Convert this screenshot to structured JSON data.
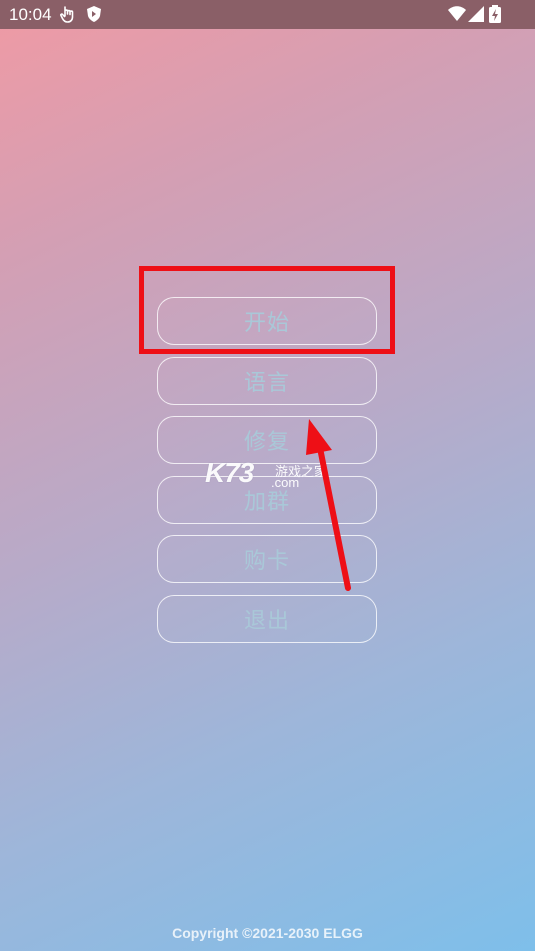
{
  "status_bar": {
    "time": "10:04",
    "icons": [
      "touch-icon",
      "app-shield-icon",
      "wifi-icon",
      "signal-icon",
      "battery-charging-icon"
    ]
  },
  "menu": {
    "items": [
      {
        "label": "开始"
      },
      {
        "label": "语言"
      },
      {
        "label": "修复"
      },
      {
        "label": "加群"
      },
      {
        "label": "购卡"
      },
      {
        "label": "退出"
      }
    ]
  },
  "watermark": {
    "logo": "K73",
    "cn": "游戏之家",
    "domain": ".com"
  },
  "footer": {
    "copyright": "Copyright ©2021-2030 ELGG"
  },
  "colors": {
    "gradient_start": "#f09aa4",
    "gradient_end": "#7ebfea",
    "status_bar_bg": "#8a5f67",
    "button_text": "#a9c8d8",
    "annotation_red": "#ee0f16"
  }
}
